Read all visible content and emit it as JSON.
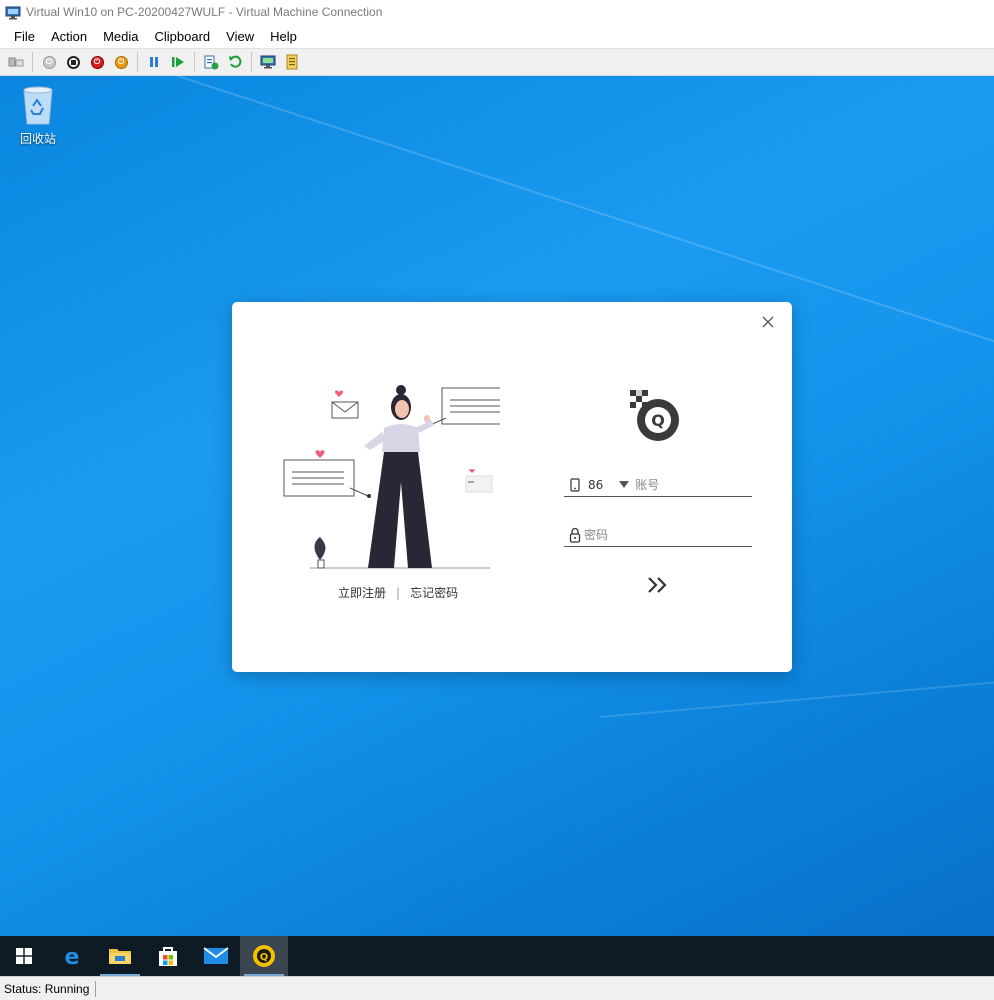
{
  "window": {
    "title": "Virtual Win10 on PC-20200427WULF - Virtual Machine Connection"
  },
  "menu": {
    "items": [
      "File",
      "Action",
      "Media",
      "Clipboard",
      "View",
      "Help"
    ]
  },
  "toolbar": {
    "icons": [
      "ctrl-alt-del-icon",
      "start-icon",
      "turn-off-icon",
      "shutdown-icon",
      "save-icon",
      "pause-icon",
      "resume-icon",
      "checkpoint-icon",
      "revert-icon",
      "enhanced-session-icon",
      "share-icon"
    ]
  },
  "desktop": {
    "recycle_bin_label": "回收站"
  },
  "login": {
    "country_code": "86",
    "account_placeholder": "账号",
    "password_placeholder": "密码",
    "register_link": "立即注册",
    "separator": "|",
    "forgot_link": "忘记密码",
    "submit_glyph": "»"
  },
  "taskbar": {
    "items": [
      "windows-start",
      "edge",
      "file-explorer",
      "microsoft-store",
      "mail",
      "qq-app"
    ]
  },
  "status": {
    "text": "Status: Running"
  },
  "colors": {
    "desktop_blue": "#1494ec",
    "taskbar": "#0e1a24",
    "heart": "#f0607a"
  }
}
